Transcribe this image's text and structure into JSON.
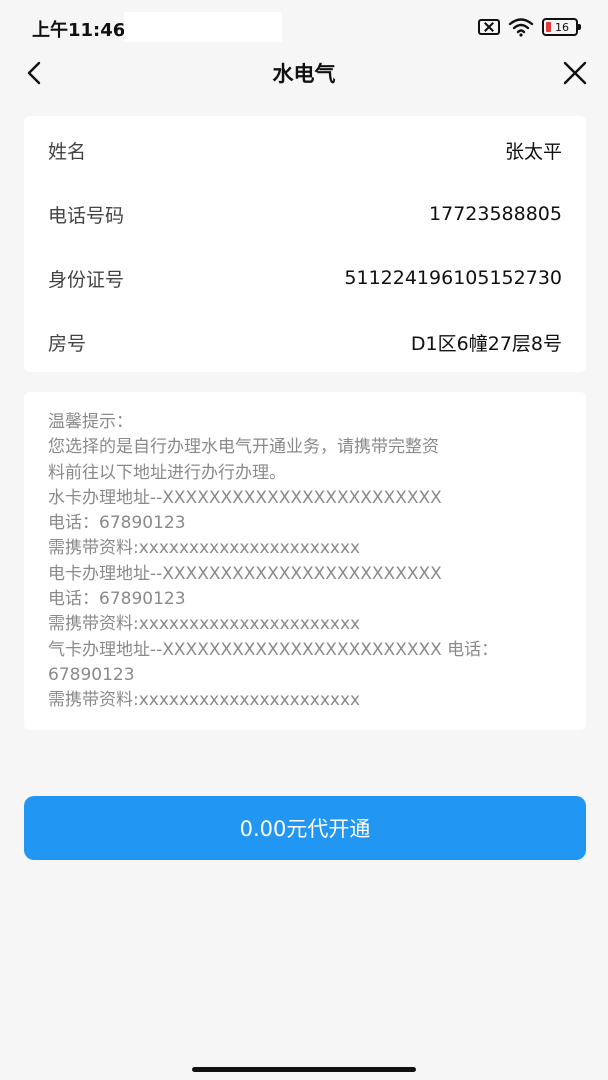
{
  "status_bar": {
    "time": "上午11:46",
    "battery_level": "16",
    "icons": [
      "sim-blocked-icon",
      "wifi-icon",
      "battery-icon"
    ]
  },
  "nav": {
    "title": "水电气",
    "back_icon": "chevron-left-icon",
    "close_icon": "close-icon"
  },
  "info": {
    "rows": [
      {
        "label": "姓名",
        "value": "张太平"
      },
      {
        "label": "电话号码",
        "value": "17723588805"
      },
      {
        "label": "身份证号",
        "value": "511224196105152730"
      },
      {
        "label": "房号",
        "value": "D1区6幢27层8号"
      }
    ]
  },
  "notice": {
    "lines": [
      "温馨提示：",
      "您选择的是自行办理水电气开通业务，请携带完整资",
      "料前往以下地址进行办行办理。",
      "水卡办理地址--XXXXXXXXXXXXXXXXXXXXXXXX",
      "电话：67890123",
      "需携带资料:xxxxxxxxxxxxxxxxxxxxxx",
      "电卡办理地址--XXXXXXXXXXXXXXXXXXXXXXXX",
      "电话：67890123",
      "需携带资料:xxxxxxxxxxxxxxxxxxxxxx",
      "气卡办理地址--XXXXXXXXXXXXXXXXXXXXXXXX 电话：",
      "67890123",
      "需携带资料:xxxxxxxxxxxxxxxxxxxxxx"
    ]
  },
  "action": {
    "button_label": "0.00元代开通"
  },
  "colors": {
    "accent": "#2196f3",
    "background": "#f6f6f6",
    "card": "#ffffff",
    "notice_text": "#8a8a8a"
  }
}
